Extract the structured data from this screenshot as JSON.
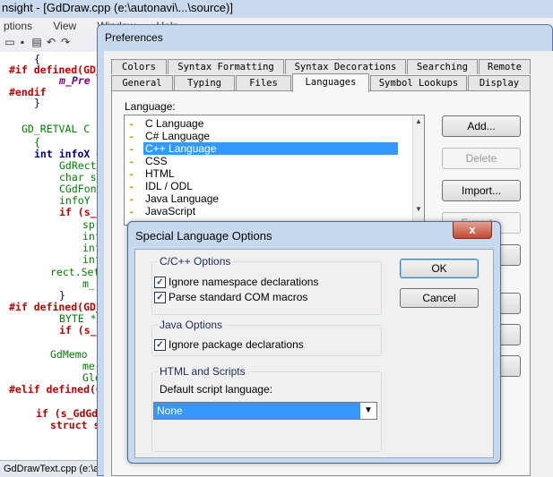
{
  "editor": {
    "title": "nsight - [GdDraw.cpp (e:\\autonavi\\...\\source)]",
    "menu": [
      "ptions",
      "View",
      "Window",
      "Help"
    ],
    "toolbar_icons": [
      "open-icon",
      "save-icon",
      "paste-icon",
      "undo-icon",
      "redo-icon"
    ],
    "code_lines": [
      {
        "text": "{"
      },
      {
        "text": "#if defined(GD_"
      },
      {
        "text": "m_Pre"
      },
      {
        "text": "#endif"
      },
      {
        "text": "}"
      },
      {
        "text": "GD_RETVAL C"
      },
      {
        "text": "{"
      },
      {
        "text": "int infoX ="
      },
      {
        "text": "GdRect"
      },
      {
        "text": "char sz"
      },
      {
        "text": "CGdFon"
      },
      {
        "text": "infoY ="
      },
      {
        "text": "if (s_G"
      },
      {
        "text": "spr"
      },
      {
        "text": "info"
      },
      {
        "text": "info"
      },
      {
        "text": "info"
      },
      {
        "text": "rect.Set("
      },
      {
        "text": "m_"
      },
      {
        "text": "}"
      },
      {
        "text": "#if defined(GD_"
      },
      {
        "text": "BYTE *p"
      },
      {
        "text": "if (s_G"
      },
      {
        "text": "GdMemo"
      },
      {
        "text": "me"
      },
      {
        "text": "Glo"
      },
      {
        "text": "#elif defined(GD"
      },
      {
        "text": "if (s_GdGd"
      },
      {
        "text": "struct sy"
      }
    ],
    "status": "GdDrawText.cpp (e:\\a"
  },
  "preferences": {
    "title": "Preferences",
    "tabs_row1": [
      "Colors",
      "Syntax Formatting",
      "Syntax Decorations",
      "Searching",
      "Remote"
    ],
    "tabs_row2": [
      "General",
      "Typing",
      "Files",
      "Languages",
      "Symbol Lookups",
      "Display"
    ],
    "active_tab": "Languages",
    "language_label": "Language:",
    "languages": [
      "C Language",
      "C# Language",
      "C++ Language",
      "CSS",
      "HTML",
      "IDL / ODL",
      "Java Language",
      "JavaScript"
    ],
    "selected_language": "C++ Language",
    "buttons": {
      "add": "Add...",
      "delete": "Delete",
      "import": "Import...",
      "export": "Export..."
    }
  },
  "special_options": {
    "title": "Special Language Options",
    "close_glyph": "x",
    "cpp_group": "C/C++ Options",
    "cpp_opt1": "Ignore namespace declarations",
    "cpp_opt2": "Parse standard COM macros",
    "java_group": "Java Options",
    "java_opt1": "Ignore package declarations",
    "html_group": "HTML and Scripts",
    "script_label": "Default script language:",
    "script_value": "None",
    "ok": "OK",
    "cancel": "Cancel",
    "checks": {
      "cpp_opt1": true,
      "cpp_opt2": true,
      "java_opt1": true
    }
  }
}
